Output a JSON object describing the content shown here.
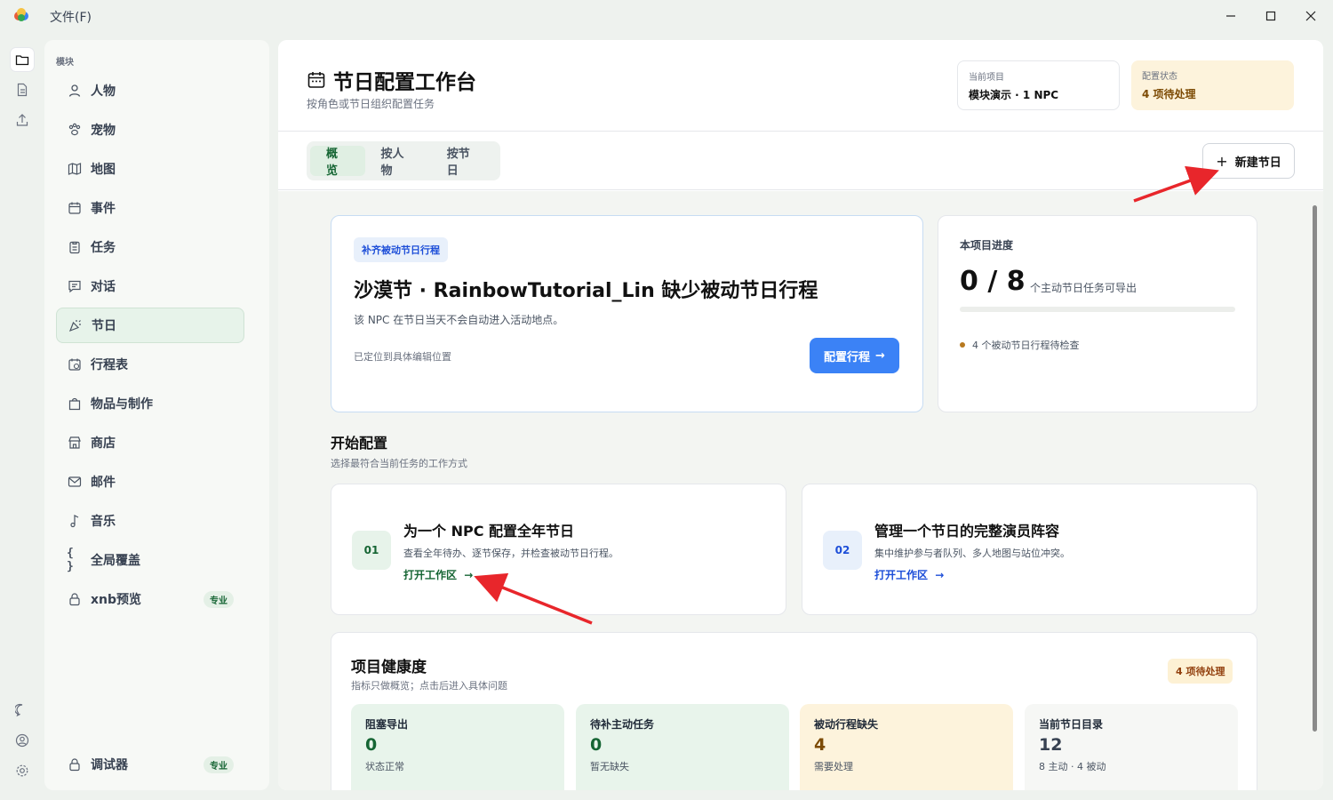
{
  "titlebar": {
    "menu_file": "文件(F)"
  },
  "sidebar": {
    "section_title": "模块",
    "items": [
      {
        "label": "人物",
        "icon": "person-icon"
      },
      {
        "label": "宠物",
        "icon": "paw-icon"
      },
      {
        "label": "地图",
        "icon": "map-icon"
      },
      {
        "label": "事件",
        "icon": "calendar-icon"
      },
      {
        "label": "任务",
        "icon": "clipboard-icon"
      },
      {
        "label": "对话",
        "icon": "chat-icon"
      },
      {
        "label": "节日",
        "icon": "party-icon",
        "active": true
      },
      {
        "label": "行程表",
        "icon": "schedule-icon"
      },
      {
        "label": "物品与制作",
        "icon": "bag-icon"
      },
      {
        "label": "商店",
        "icon": "store-icon"
      },
      {
        "label": "邮件",
        "icon": "mail-icon"
      },
      {
        "label": "音乐",
        "icon": "music-icon"
      },
      {
        "label": "全局覆盖",
        "icon": "braces-icon"
      },
      {
        "label": "xnb预览",
        "icon": "lock-icon",
        "badge": "专业"
      }
    ],
    "debugger": {
      "label": "调试器",
      "badge": "专业"
    }
  },
  "header": {
    "title": "节日配置工作台",
    "subtitle": "按角色或节日组织配置任务",
    "current_project": {
      "label": "当前项目",
      "value": "模块演示 · 1 NPC"
    },
    "config_status": {
      "label": "配置状态",
      "value": "4 项待处理"
    }
  },
  "tabs": [
    "概览",
    "按人物",
    "按节日"
  ],
  "new_button": "新建节日",
  "alert": {
    "badge": "补齐被动节日行程",
    "title": "沙漠节 · RainbowTutorial_Lin 缺少被动节日行程",
    "desc": "该 NPC 在节日当天不会自动进入活动地点。",
    "location": "已定位到具体编辑位置",
    "button": "配置行程"
  },
  "progress": {
    "label": "本项目进度",
    "value": "0 / 8",
    "unit": "个主动节日任务可导出",
    "fraction": 0.0,
    "note": "4 个被动节日行程待检查"
  },
  "start": {
    "title": "开始配置",
    "subtitle": "选择最符合当前任务的工作方式",
    "cards": [
      {
        "num": "01",
        "title": "为一个 NPC 配置全年节日",
        "desc": "查看全年待办、逐节保存，并检查被动节日行程。",
        "link": "打开工作区"
      },
      {
        "num": "02",
        "title": "管理一个节日的完整演员阵容",
        "desc": "集中维护参与者队列、多人地图与站位冲突。",
        "link": "打开工作区"
      }
    ]
  },
  "health": {
    "title": "项目健康度",
    "subtitle": "指标只做概览；点击后进入具体问题",
    "badge": "4 项待处理",
    "metrics": [
      {
        "label": "阻塞导出",
        "value": "0",
        "note": "状态正常"
      },
      {
        "label": "待补主动任务",
        "value": "0",
        "note": "暂无缺失"
      },
      {
        "label": "被动行程缺失",
        "value": "4",
        "note": "需要处理"
      },
      {
        "label": "当前节日目录",
        "value": "12",
        "note": "8 主动 · 4 被动"
      }
    ]
  },
  "colors": {
    "accent_green": "#166534",
    "accent_blue": "#3b82f6",
    "warning": "#b7791f",
    "annotation_red": "#e8262b"
  }
}
